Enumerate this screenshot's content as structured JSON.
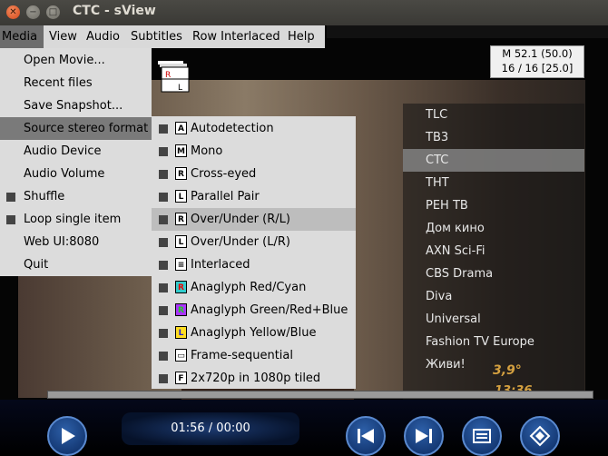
{
  "window": {
    "title": "CTC - sView"
  },
  "menubar": {
    "items": [
      "Media",
      "View",
      "Audio",
      "Subtitles",
      "Row Interlaced",
      "Help"
    ]
  },
  "media_menu": {
    "items": [
      {
        "label": "Open Movie...",
        "check": false
      },
      {
        "label": "Recent files",
        "check": false
      },
      {
        "label": "Save Snapshot...",
        "check": false
      },
      {
        "label": "Source stereo format",
        "check": false,
        "highlighted": true
      },
      {
        "label": "Audio Device",
        "check": false
      },
      {
        "label": "Audio Volume",
        "check": false
      },
      {
        "label": "Shuffle",
        "check": true
      },
      {
        "label": "Loop single item",
        "check": true
      },
      {
        "label": "Web UI:8080",
        "check": false
      },
      {
        "label": "Quit",
        "check": false
      }
    ]
  },
  "stereo_menu": {
    "items": [
      {
        "label": "Autodetection",
        "icon": "A"
      },
      {
        "label": "Mono",
        "icon": "M"
      },
      {
        "label": "Cross-eyed",
        "icon": "RL"
      },
      {
        "label": "Parallel Pair",
        "icon": "LR"
      },
      {
        "label": "Over/Under (R/L)",
        "icon": "RL",
        "highlighted": true
      },
      {
        "label": "Over/Under (L/R)",
        "icon": "LR"
      },
      {
        "label": "Interlaced",
        "icon": "≡"
      },
      {
        "label": "Anaglyph Red/Cyan",
        "icon": "R"
      },
      {
        "label": "Anaglyph Green/Red+Blue",
        "icon": "R"
      },
      {
        "label": "Anaglyph Yellow/Blue",
        "icon": "L"
      },
      {
        "label": "Frame-sequential",
        "icon": "▭"
      },
      {
        "label": "2x720p in 1080p tiled",
        "icon": "F"
      }
    ]
  },
  "info_box": {
    "line1": "M 52.1 (50.0)",
    "line2": "16 / 16 [25.0]"
  },
  "channels": {
    "items": [
      "TLC",
      "TB3",
      "CTC",
      "THT",
      "PEH TB",
      "Дом кино",
      "AXN Sci-Fi",
      "CBS Drama",
      "Diva",
      "Universal",
      "Fashion TV Europe",
      "Живи!"
    ],
    "selected_index": 2
  },
  "overlay": {
    "weather_temp": "3,9°",
    "weather_time": "13:36"
  },
  "player": {
    "time": "01:56 / 00:00"
  },
  "colors": {
    "accent": "#2d5fa8",
    "menu_bg": "#dcdcdc",
    "highlight": "#7a7a7a"
  }
}
